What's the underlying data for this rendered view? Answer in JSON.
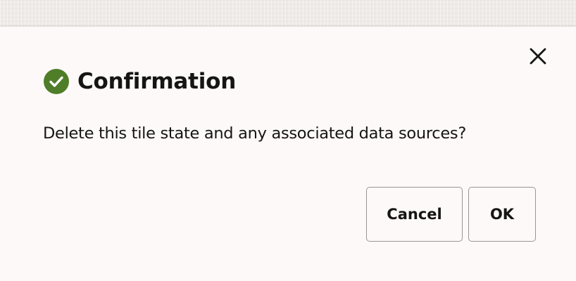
{
  "dialog": {
    "title": "Confirmation",
    "title_icon": "check-circle-icon",
    "message": "Delete this tile state and any associated data sources?",
    "close_icon": "close-icon",
    "buttons": {
      "cancel_label": "Cancel",
      "ok_label": "OK"
    }
  },
  "colors": {
    "success": "#4f7d28",
    "text": "#161513",
    "dialog_background": "#fcf9f8",
    "button_border": "#9a9590"
  }
}
